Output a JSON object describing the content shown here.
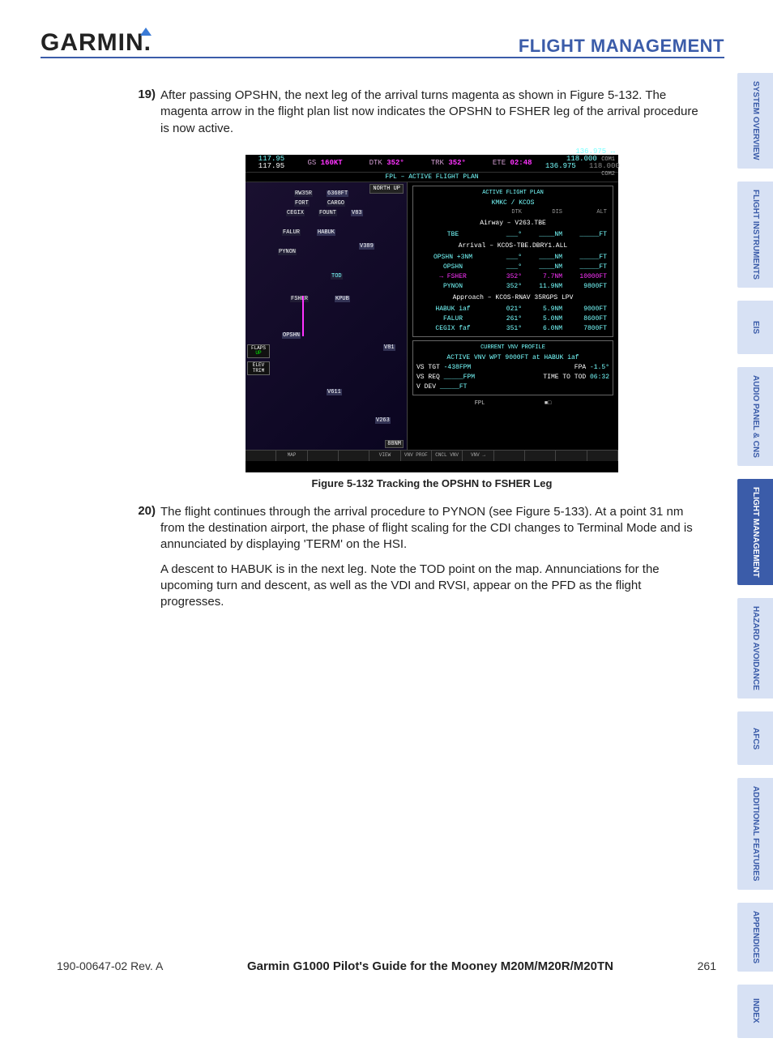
{
  "header": {
    "logo_text": "GARMIN",
    "section": "FLIGHT MANAGEMENT"
  },
  "tabs": [
    {
      "label": "SYSTEM OVERVIEW",
      "active": false
    },
    {
      "label": "FLIGHT INSTRUMENTS",
      "active": false
    },
    {
      "label": "EIS",
      "active": false
    },
    {
      "label": "AUDIO PANEL & CNS",
      "active": false
    },
    {
      "label": "FLIGHT MANAGEMENT",
      "active": true
    },
    {
      "label": "HAZARD AVOIDANCE",
      "active": false
    },
    {
      "label": "AFCS",
      "active": false
    },
    {
      "label": "ADDITIONAL FEATURES",
      "active": false
    },
    {
      "label": "APPENDICES",
      "active": false
    },
    {
      "label": "INDEX",
      "active": false
    }
  ],
  "steps": {
    "s19_num": "19)",
    "s19_body": "After passing OPSHN, the next leg of the arrival turns magenta as shown in Figure 5-132.  The magenta arrow in the flight plan list now indicates the OPSHN to FSHER leg of the arrival procedure is now active.",
    "s20_num": "20)",
    "s20_p1": "The flight continues through the arrival procedure  to PYNON (see Figure 5-133).  At a point 31 nm from the destination airport, the phase of flight scaling for the CDI changes to Terminal Mode and is annunciated by displaying 'TERM' on the HSI.",
    "s20_p2": "A descent to HABUK is in the next leg.  Note the TOD point on the map.  Annunciations for the upcoming turn and descent, as well as the VDI and RVSI, appear on the PFD as the flight progresses."
  },
  "figure": {
    "caption": "Figure 5-132  Tracking the OPSHN to FSHER Leg",
    "nav1": "117.95",
    "nav2": "117.95",
    "gs_label": "GS",
    "gs": "160KT",
    "dtk_label": "DTK",
    "dtk": "352°",
    "trk_label": "TRK",
    "trk": "352°",
    "ete_label": "ETE",
    "ete": "02:48",
    "com1": "136.975",
    "com1b": "118.000",
    "com1_sub": "COM1",
    "com2": "136.975",
    "com2b": "118.000",
    "com2_sub": "COM2",
    "page_title": "FPL – ACTIVE FLIGHT PLAN",
    "northup": "NORTH UP",
    "map_range": "88NM",
    "map_wps": {
      "rw35r": "RW35R",
      "alt1": "6368FT",
      "cargo": "CARGO",
      "fort": "FORT",
      "cegix": "CEGIX",
      "fount": "FOUNT",
      "v83": "V83",
      "falur": "FALUR",
      "habuk": "HABUK",
      "pynon": "PYNON",
      "v389": "V389",
      "v83b": "V83",
      "tod": "TOD",
      "fsher": "FSHER",
      "kpub": "KPUB",
      "opshn": "OPSHN",
      "v611": "V611",
      "v81": "V81",
      "v263": "V263"
    },
    "flaps_label": "FLAPS",
    "flaps_val": "UP",
    "elev_label": "ELEV TRIM",
    "fpl": {
      "box_title": "ACTIVE FLIGHT PLAN",
      "route": "KMKC / KCOS",
      "col_dtk": "DTK",
      "col_dis": "DIS",
      "col_alt": "ALT",
      "airway_label": "Airway – V263.TBE",
      "rows": [
        {
          "name": "TBE",
          "dtk": "___°",
          "dis": "____NM",
          "alt": "_____FT",
          "active": false
        },
        {
          "name": "Arrival – KCOS-TBE.DBRY1.ALL",
          "section": true
        },
        {
          "name": "OPSHN +3NM",
          "dtk": "___°",
          "dis": "____NM",
          "alt": "_____FT",
          "active": false
        },
        {
          "name": "OPSHN",
          "dtk": "___°",
          "dis": "____NM",
          "alt": "_____FT",
          "active": false
        },
        {
          "name": "FSHER",
          "dtk": "352°",
          "dis": "7.7NM",
          "alt": "10000FT",
          "active": true
        },
        {
          "name": "PYNON",
          "dtk": "352°",
          "dis": "11.9NM",
          "alt": "9800FT",
          "active": false
        },
        {
          "name": "Approach – KCOS-RNAV 35RGPS LPV",
          "section": true
        },
        {
          "name": "HABUK iaf",
          "dtk": "021°",
          "dis": "5.9NM",
          "alt": "9000FT",
          "active": false
        },
        {
          "name": "FALUR",
          "dtk": "261°",
          "dis": "5.0NM",
          "alt": "8600FT",
          "active": false
        },
        {
          "name": "CEGIX faf",
          "dtk": "351°",
          "dis": "6.0NM",
          "alt": "7800FT",
          "active": false
        }
      ],
      "vnv_title": "CURRENT VNV PROFILE",
      "vnv_active": "ACTIVE VNV WPT   9000FT  at  HABUK iaf",
      "vstgt_lbl": "VS TGT",
      "vstgt": "-438FPM",
      "fpa_lbl": "FPA",
      "fpa": "-1.5°",
      "vsreq_lbl": "VS REQ",
      "vsreq": "_____FPM",
      "ttt_lbl": "TIME TO TOD",
      "ttt": "06:32",
      "vdev_lbl": "V DEV",
      "vdev": "_____FT"
    },
    "softbar2": {
      "fpl": "FPL",
      "sq": "■□"
    },
    "softkeys": [
      "",
      "MAP",
      "",
      "",
      "VIEW",
      "VNV PROF",
      "CNCL VNV",
      "VNV →",
      "",
      "",
      "",
      ""
    ]
  },
  "footer": {
    "doc_rev": "190-00647-02  Rev. A",
    "guide": "Garmin G1000 Pilot's Guide for the Mooney M20M/M20R/M20TN",
    "page": "261"
  }
}
